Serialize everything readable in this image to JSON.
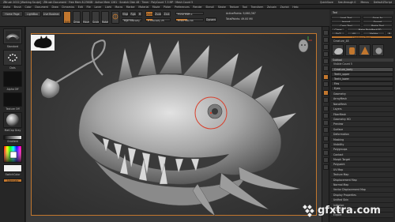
{
  "titlebar": {
    "title": "ZBrush 2022 [Working Sculpt] · ZBrush Document · Free Mem 8.236GB · Active Mem 1261 · Scratch Disk 48 · Timer · PolyCount 7.3 MP · Mesh Count 5",
    "right_items": [
      "QuickSave",
      "See-through 0",
      "Menus",
      "DefaultZScript"
    ]
  },
  "menubar": {
    "items": [
      "Alpha",
      "Brush",
      "Color",
      "Document",
      "Draw",
      "Dynamics",
      "Edit",
      "File",
      "Layer",
      "Light",
      "Macro",
      "Marker",
      "Material",
      "Movie",
      "Picker",
      "Preferences",
      "Render",
      "Stencil",
      "Stroke",
      "Texture",
      "Tool",
      "Transform",
      "Zplugin",
      "Zscript",
      "Help"
    ]
  },
  "toptoolbar": {
    "home_label": "Home Page",
    "lightbox_label": "LightBox",
    "liveboolean_label": "Live Boolean",
    "edit_label": "Edit",
    "draw_label": "Draw",
    "move_label": "Move",
    "scale_label": "Scale",
    "rotate_label": "Rotate",
    "mrgb_label": "Mrgb",
    "rgb_label": "Rgb",
    "m_label": "M",
    "zadd_label": "Zadd",
    "zsub_label": "Zsub",
    "zcut_label": "Zcut",
    "rgb_intensity_label": "Rgb Intensity",
    "z_intensity_label": "Z Intensity 25",
    "focal_shift_label": "Focal Shift 0",
    "draw_size_label": "Draw Size 64",
    "dynamic_label": "Dynamic",
    "active_points_label": "ActivePoints: 9,660,367",
    "total_points_label": "TotalPoints: 49.00 Mil"
  },
  "leftshelf": {
    "brush_label": "Standard",
    "stroke_label": "Dots",
    "alpha_label": "Alpha Off",
    "texture_label": "Texture Off",
    "material_label": "MatCap Gray",
    "gradient_label": "Gradient",
    "switch_color_label": "SwitchColor",
    "alternate_label": "Alternate"
  },
  "rightpanel": {
    "header": "Tool",
    "load_tool": "Load Tool",
    "save_as": "Save As",
    "import": "Import",
    "export": "Export",
    "copy_tool": "Copy Tool",
    "paste_tool": "Paste Tool",
    "clone": "Clone",
    "make_polymesh": "Make PolyMesh3D",
    "goz": "GoZ",
    "all": "All",
    "visible": "Visible",
    "r": "R",
    "lightbox_tools": "Lightbox▸Tools",
    "current_tool": "Creature_48",
    "tool_names": [
      "Creature_48",
      "Cylinder3D",
      "PolyMesh3D",
      "SimpleBrush",
      "Creature_48"
    ],
    "subtool": "Subtool",
    "visible_count": "Visible Count 5",
    "sections": [
      "Geometry",
      "ArrayMesh",
      "NanoMesh",
      "Layers",
      "FiberMesh",
      "Geometry HD",
      "Preview",
      "Surface",
      "Deformation",
      "Masking",
      "Visibility",
      "Polygroups",
      "Contact",
      "Morph Target",
      "Polypaint",
      "UV Map",
      "Texture Map",
      "Displacement Map",
      "Normal Map",
      "Vector Displacement Map",
      "Display Properties",
      "Unified Skin",
      "Initialize",
      "Import",
      "Export"
    ],
    "subtool_items": [
      "Creature_body",
      "Teeth_upper",
      "Teeth_lower",
      "Fins",
      "Eyes"
    ]
  },
  "colors": {
    "accent": "#c2772e",
    "background": "#1f1f1f",
    "panel": "#262626",
    "viewport": "#3a3a3a",
    "cursor_ring": "#d8402c"
  },
  "watermark": {
    "text": "gfxtra.com"
  }
}
